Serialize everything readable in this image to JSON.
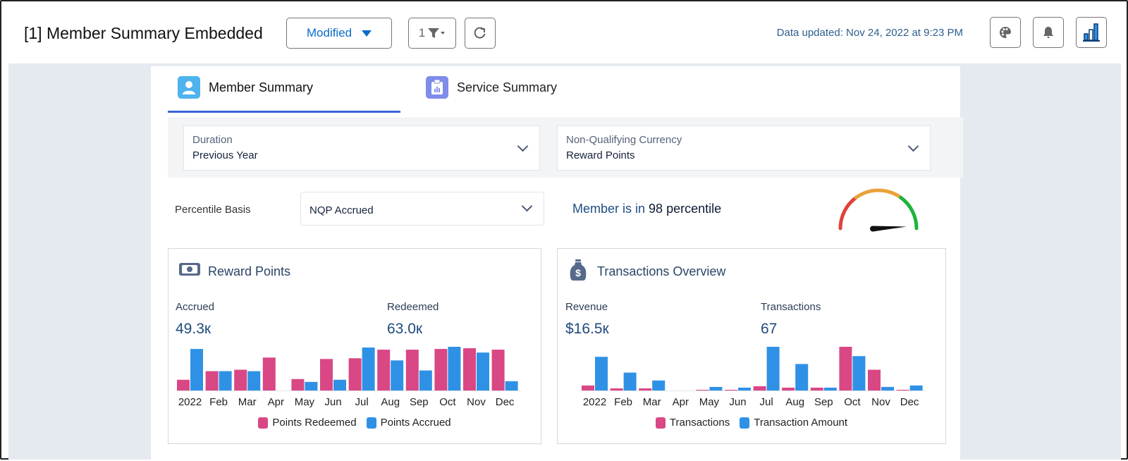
{
  "header": {
    "title": "[1] Member Summary Embedded",
    "view_dropdown": "Modified",
    "filter_count": "1",
    "data_updated": "Data updated: Nov 24, 2022 at 9:23 PM",
    "icons": [
      "palette-icon",
      "bell-icon",
      "bar-chart-icon"
    ]
  },
  "tabs": [
    {
      "label": "Member Summary",
      "icon": "person-icon",
      "active": true
    },
    {
      "label": "Service Summary",
      "icon": "clipboard-chart-icon",
      "active": false
    }
  ],
  "filters": {
    "duration": {
      "label": "Duration",
      "value": "Previous Year"
    },
    "currency": {
      "label": "Non-Qualifying Currency",
      "value": "Reward Points"
    },
    "percentile_basis": {
      "label": "Percentile Basis",
      "value": "NQP Accrued"
    }
  },
  "percentile": {
    "prefix": "Member is in",
    "value": "98",
    "suffix": "percentile",
    "gauge_fraction": 0.98,
    "gauge_colors": [
      "#e0423b",
      "#e8a23a",
      "#1db43a"
    ]
  },
  "colors": {
    "pink": "#d94785",
    "blue": "#2f91e6"
  },
  "reward_card": {
    "title": "Reward Points",
    "kpis": [
      {
        "label": "Accrued",
        "value": "49.3к"
      },
      {
        "label": "Redeemed",
        "value": "63.0к"
      }
    ]
  },
  "transactions_card": {
    "title": "Transactions Overview",
    "kpis": [
      {
        "label": "Revenue",
        "value": "$16.5к"
      },
      {
        "label": "Transactions",
        "value": "67"
      }
    ]
  },
  "chart_data": [
    {
      "type": "bar",
      "title": "Reward Points",
      "categories": [
        "2022",
        "Feb",
        "Mar",
        "Apr",
        "May",
        "Jun",
        "Jul",
        "Aug",
        "Sep",
        "Oct",
        "Nov",
        "Dec"
      ],
      "series": [
        {
          "name": "Points Redeemed",
          "color": "#d94785",
          "values": [
            15,
            27,
            29,
            46,
            16,
            44,
            45,
            57,
            57,
            58,
            59,
            57
          ]
        },
        {
          "name": "Points Accrued",
          "color": "#2f91e6",
          "values": [
            58,
            27,
            27,
            0,
            12,
            15,
            60,
            42,
            28,
            61,
            53,
            13
          ]
        }
      ],
      "ylim": [
        0,
        61
      ],
      "legend": "bottom",
      "grid": false
    },
    {
      "type": "bar",
      "title": "Transactions Overview",
      "categories": [
        "2022",
        "Feb",
        "Mar",
        "Apr",
        "May",
        "Jun",
        "Jul",
        "Aug",
        "Sep",
        "Oct",
        "Nov",
        "Dec"
      ],
      "series": [
        {
          "name": "Transactions",
          "color": "#d94785",
          "values": [
            7,
            3,
            3,
            0,
            1,
            1,
            6,
            4,
            4,
            61,
            29,
            1
          ]
        },
        {
          "name": "Transaction Amount",
          "color": "#2f91e6",
          "values": [
            47,
            25,
            14,
            0,
            5,
            4,
            61,
            37,
            4,
            48,
            5,
            7
          ]
        }
      ],
      "ylim": [
        0,
        61
      ],
      "legend": "bottom",
      "grid": false
    }
  ]
}
